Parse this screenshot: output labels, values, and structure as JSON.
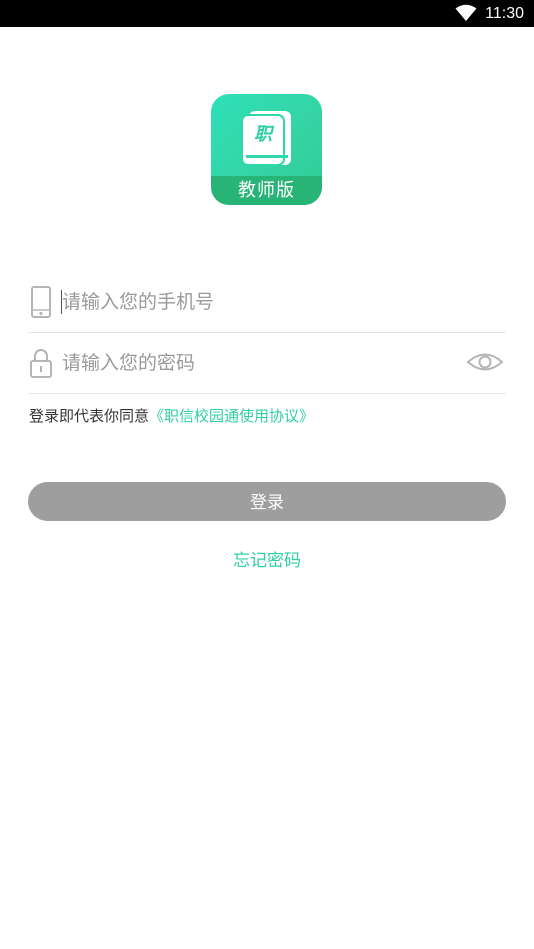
{
  "status_bar": {
    "time": "11:30",
    "icons": [
      "wifi-icon"
    ]
  },
  "logo": {
    "book_glyph": "职",
    "edition": "教师版"
  },
  "phone_field": {
    "placeholder": "请输入您的手机号",
    "value": "",
    "icon": "phone-icon"
  },
  "password_field": {
    "placeholder": "请输入您的密码",
    "value": "",
    "icon": "lock-icon",
    "toggle_icon": "eye-icon"
  },
  "agreement": {
    "prefix": "登录即代表你同意",
    "link": "《职信校园通使用协议》"
  },
  "login_button": {
    "label": "登录"
  },
  "forgot_password": {
    "label": "忘记密码"
  },
  "colors": {
    "accent": "#2fcfa5",
    "logo_band": "#27b476",
    "button_disabled": "#9e9e9e",
    "status_bar": "#000000"
  }
}
